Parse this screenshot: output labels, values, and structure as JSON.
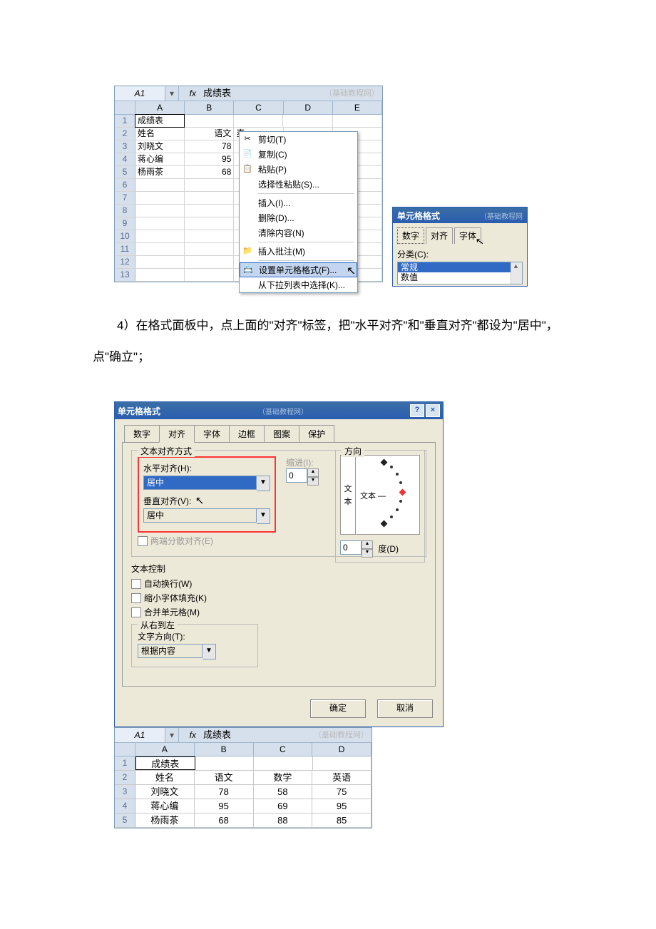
{
  "fig1": {
    "namebox": "A1",
    "fx_label": "fx",
    "formula_value": "成绩表",
    "watermark": "（基础教程网）",
    "dropdown_sym": "▾",
    "columns": [
      "A",
      "B",
      "C",
      "D",
      "E"
    ],
    "rows": [
      {
        "n": "1",
        "cells": [
          "成绩表",
          "",
          "",
          "",
          ""
        ]
      },
      {
        "n": "2",
        "cells": [
          "姓名",
          "语文",
          "麦",
          "",
          ""
        ]
      },
      {
        "n": "3",
        "cells": [
          "刘晓文",
          "78",
          "",
          "",
          ""
        ]
      },
      {
        "n": "4",
        "cells": [
          "蒋心编",
          "95",
          "",
          "",
          ""
        ]
      },
      {
        "n": "5",
        "cells": [
          "杨雨茶",
          "68",
          "",
          "",
          ""
        ]
      },
      {
        "n": "6",
        "cells": [
          "",
          "",
          "",
          "",
          ""
        ]
      },
      {
        "n": "7",
        "cells": [
          "",
          "",
          "",
          "",
          ""
        ]
      },
      {
        "n": "8",
        "cells": [
          "",
          "",
          "",
          "",
          ""
        ]
      },
      {
        "n": "9",
        "cells": [
          "",
          "",
          "",
          "",
          ""
        ]
      },
      {
        "n": "10",
        "cells": [
          "",
          "",
          "",
          "",
          ""
        ]
      },
      {
        "n": "11",
        "cells": [
          "",
          "",
          "",
          "",
          ""
        ]
      },
      {
        "n": "12",
        "cells": [
          "",
          "",
          "",
          "",
          ""
        ]
      },
      {
        "n": "13",
        "cells": [
          "",
          "",
          "",
          "",
          ""
        ]
      }
    ],
    "context_menu": {
      "items": [
        {
          "icon": "✂",
          "label": "剪切(T)"
        },
        {
          "icon": "📄",
          "label": "复制(C)"
        },
        {
          "icon": "📋",
          "label": "粘贴(P)"
        },
        {
          "icon": "",
          "label": "选择性粘贴(S)..."
        },
        {
          "sep": true
        },
        {
          "icon": "",
          "label": "插入(I)..."
        },
        {
          "icon": "",
          "label": "删除(D)..."
        },
        {
          "icon": "",
          "label": "清除内容(N)"
        },
        {
          "sep": true
        },
        {
          "icon": "📁",
          "label": "插入批注(M)"
        },
        {
          "sep": true
        },
        {
          "icon": "📇",
          "label": "设置单元格格式(F)...",
          "hl": true
        },
        {
          "icon": "",
          "label": "从下拉列表中选择(K)..."
        }
      ]
    },
    "format_teaser": {
      "title": "单元格格式",
      "wm": "（基础教程网",
      "tabs": [
        "数字",
        "对齐",
        "字体"
      ],
      "cat_label": "分类(C):",
      "list": [
        "常规",
        "数值"
      ]
    }
  },
  "para_text": "4）在格式面板中，点上面的\"对齐\"标签，把\"水平对齐\"和\"垂直对齐\"都设为\"居中\"，点\"确立\"；",
  "fig2": {
    "title": "单元格格式",
    "wm": "（基础教程网）",
    "help": "?",
    "close": "×",
    "tabs": [
      "数字",
      "对齐",
      "字体",
      "边框",
      "图案",
      "保护"
    ],
    "grp_align": "文本对齐方式",
    "h_align_label": "水平对齐(H):",
    "h_align_value": "居中",
    "v_align_label": "垂直对齐(V):",
    "v_align_value": "居中",
    "indent_label": "缩进(I):",
    "indent_value": "0",
    "justify_label": "两端分散对齐(E)",
    "grp_ctrl": "文本控制",
    "wrap_label": "自动换行(W)",
    "shrink_label": "缩小字体填充(K)",
    "merge_label": "合并单元格(M)",
    "grp_rtl": "从右到左",
    "dir_label": "文字方向(T):",
    "dir_value": "根据内容",
    "grp_orient": "方向",
    "orient_v": "文本",
    "orient_h": "文本 —",
    "deg_value": "0",
    "deg_label": "度(D)",
    "ok": "确定",
    "cancel": "取消"
  },
  "fig3": {
    "namebox": "A1",
    "fx_label": "fx",
    "formula_value": "成绩表",
    "watermark": "（基础教程网）",
    "dropdown_sym": "▾",
    "columns": [
      "A",
      "B",
      "C",
      "D"
    ],
    "rows": [
      {
        "n": "1",
        "cells": [
          "成绩表",
          "",
          "",
          ""
        ]
      },
      {
        "n": "2",
        "cells": [
          "姓名",
          "语文",
          "数学",
          "英语"
        ]
      },
      {
        "n": "3",
        "cells": [
          "刘晓文",
          "78",
          "58",
          "75"
        ]
      },
      {
        "n": "4",
        "cells": [
          "蒋心编",
          "95",
          "69",
          "95"
        ]
      },
      {
        "n": "5",
        "cells": [
          "杨雨茶",
          "68",
          "88",
          "85"
        ]
      }
    ]
  }
}
